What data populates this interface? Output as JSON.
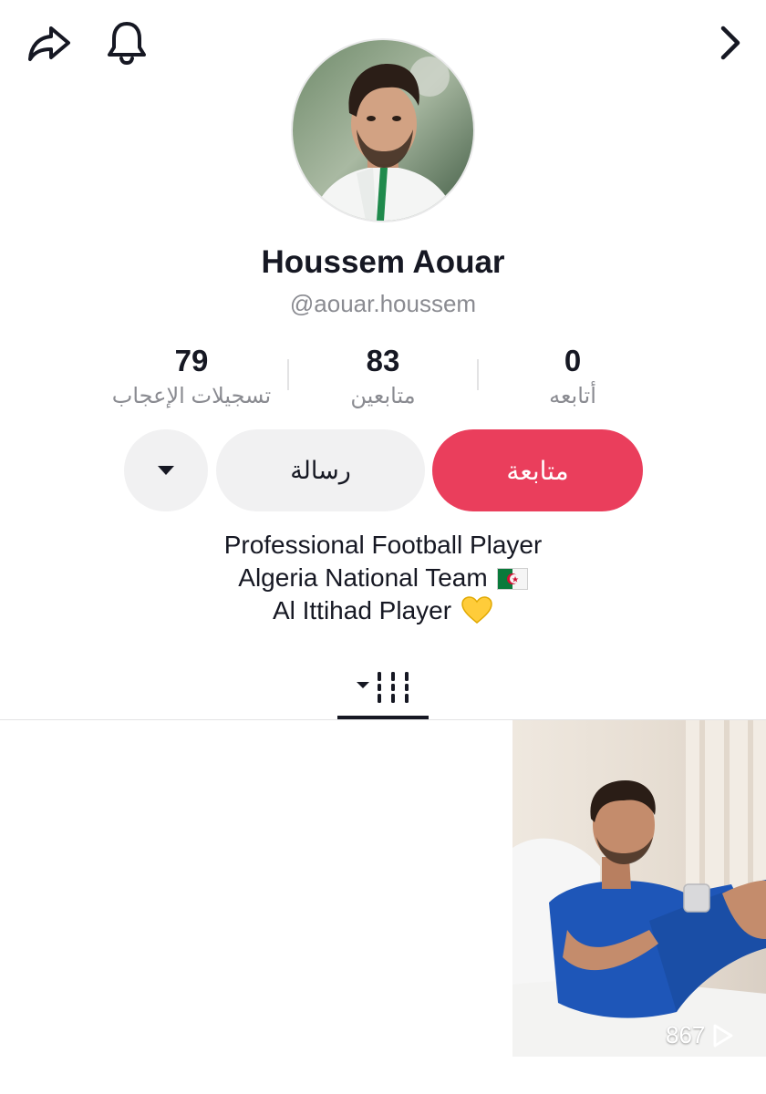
{
  "profile": {
    "display_name": "Houssem Aouar",
    "handle": "@aouar.houssem"
  },
  "stats": {
    "following": {
      "value": "0",
      "label": "أتابعه"
    },
    "followers": {
      "value": "83",
      "label": "متابعين"
    },
    "likes": {
      "value": "79",
      "label": "تسجيلات الإعجاب"
    }
  },
  "actions": {
    "follow_label": "متابعة",
    "message_label": "رسالة"
  },
  "bio": {
    "line1": "Professional Football Player",
    "line2": "Algeria National Team",
    "line3": "Al Ittihad Player"
  },
  "videos": [
    {
      "play_count": "867"
    }
  ],
  "icons": {
    "share": "share-arrow-icon",
    "bell": "bell-icon",
    "next": "chevron-right-icon",
    "more": "caret-down-icon",
    "videos_tab": "grid-lines-icon",
    "play": "play-outline-icon"
  },
  "colors": {
    "follow_button": "#ea3e5c",
    "secondary_button": "#f1f1f2",
    "muted_text": "#8a8b91",
    "primary_text": "#161823"
  }
}
